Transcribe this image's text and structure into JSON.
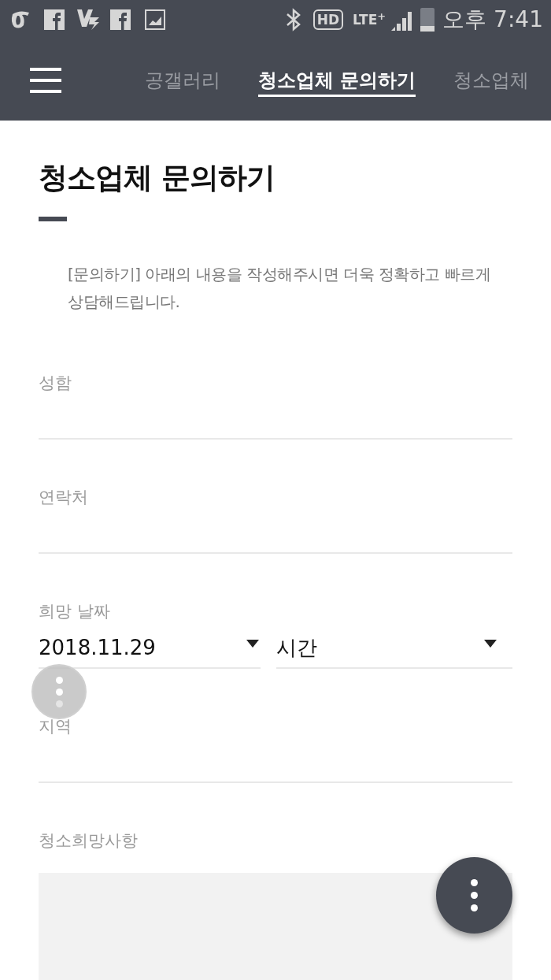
{
  "status_bar": {
    "hd": "HD",
    "network": "LTE",
    "network_plus": "+",
    "time": "오후 7:41"
  },
  "tabs": [
    {
      "label": "공갤러리",
      "selected": false
    },
    {
      "label": "청소업체 문의하기",
      "selected": true
    },
    {
      "label": "청소업체",
      "selected": false
    }
  ],
  "page": {
    "title": "청소업체 문의하기",
    "intro": "[문의하기] 아래의 내용을 작성해주시면 더욱 정확하고 빠르게 상담해드립니다."
  },
  "fields": [
    {
      "kind": "text",
      "label": "성함"
    },
    {
      "kind": "text",
      "label": "연락처"
    },
    {
      "kind": "date",
      "label": "희망 날짜",
      "date": "2018.11.29",
      "time": "시간"
    },
    {
      "kind": "text",
      "label": "지역"
    },
    {
      "kind": "textarea",
      "label": "청소희망사항"
    }
  ]
}
